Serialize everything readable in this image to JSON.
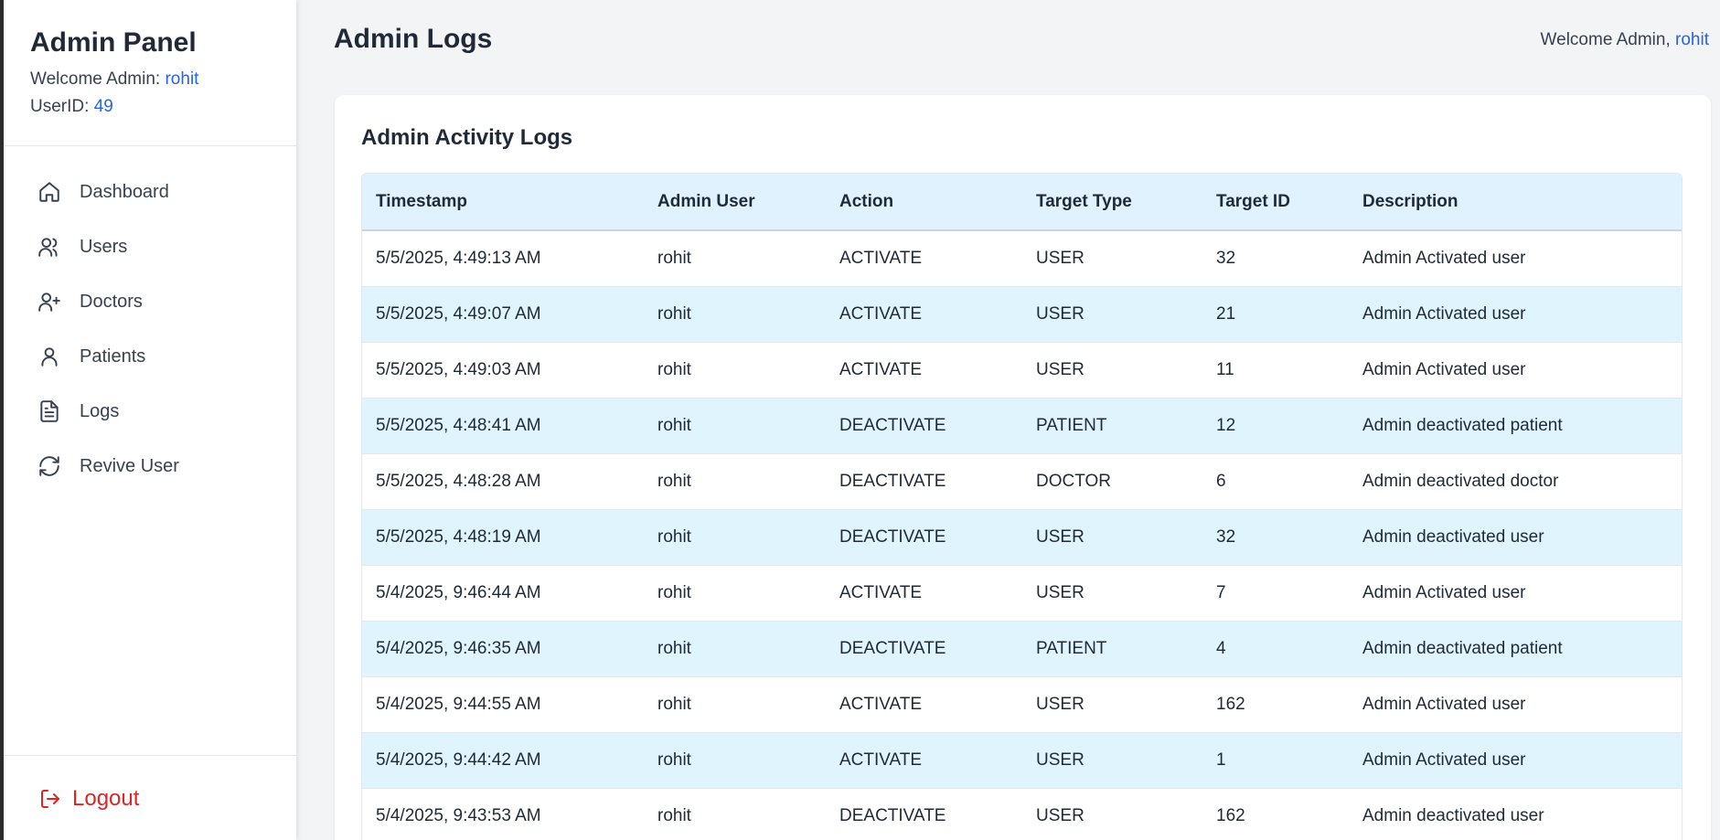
{
  "sidebar": {
    "title": "Admin Panel",
    "welcome_label": "Welcome Admin: ",
    "welcome_user": "rohit",
    "userid_label": "UserID: ",
    "userid_value": "49",
    "items": [
      {
        "label": "Dashboard",
        "icon": "home-icon"
      },
      {
        "label": "Users",
        "icon": "users-icon"
      },
      {
        "label": "Doctors",
        "icon": "user-plus-icon"
      },
      {
        "label": "Patients",
        "icon": "user-icon"
      },
      {
        "label": "Logs",
        "icon": "file-text-icon"
      },
      {
        "label": "Revive User",
        "icon": "refresh-icon"
      }
    ],
    "logout_label": "Logout"
  },
  "header": {
    "title": "Admin Logs",
    "welcome_label": "Welcome Admin, ",
    "welcome_user": "rohit"
  },
  "card": {
    "title": "Admin Activity Logs",
    "columns": [
      "Timestamp",
      "Admin User",
      "Action",
      "Target Type",
      "Target ID",
      "Description"
    ],
    "rows": [
      [
        "5/5/2025, 4:49:13 AM",
        "rohit",
        "ACTIVATE",
        "USER",
        "32",
        "Admin Activated user"
      ],
      [
        "5/5/2025, 4:49:07 AM",
        "rohit",
        "ACTIVATE",
        "USER",
        "21",
        "Admin Activated user"
      ],
      [
        "5/5/2025, 4:49:03 AM",
        "rohit",
        "ACTIVATE",
        "USER",
        "11",
        "Admin Activated user"
      ],
      [
        "5/5/2025, 4:48:41 AM",
        "rohit",
        "DEACTIVATE",
        "PATIENT",
        "12",
        "Admin deactivated patient"
      ],
      [
        "5/5/2025, 4:48:28 AM",
        "rohit",
        "DEACTIVATE",
        "DOCTOR",
        "6",
        "Admin deactivated doctor"
      ],
      [
        "5/5/2025, 4:48:19 AM",
        "rohit",
        "DEACTIVATE",
        "USER",
        "32",
        "Admin deactivated user"
      ],
      [
        "5/4/2025, 9:46:44 AM",
        "rohit",
        "ACTIVATE",
        "USER",
        "7",
        "Admin Activated user"
      ],
      [
        "5/4/2025, 9:46:35 AM",
        "rohit",
        "DEACTIVATE",
        "PATIENT",
        "4",
        "Admin deactivated patient"
      ],
      [
        "5/4/2025, 9:44:55 AM",
        "rohit",
        "ACTIVATE",
        "USER",
        "162",
        "Admin Activated user"
      ],
      [
        "5/4/2025, 9:44:42 AM",
        "rohit",
        "ACTIVATE",
        "USER",
        "1",
        "Admin Activated user"
      ],
      [
        "5/4/2025, 9:43:53 AM",
        "rohit",
        "DEACTIVATE",
        "USER",
        "162",
        "Admin deactivated user"
      ]
    ]
  },
  "colors": {
    "accent": "#2563eb",
    "logout": "#dc2626",
    "table_header_bg": "#e0f2fe",
    "row_stripe_bg": "#e0f4fd"
  }
}
